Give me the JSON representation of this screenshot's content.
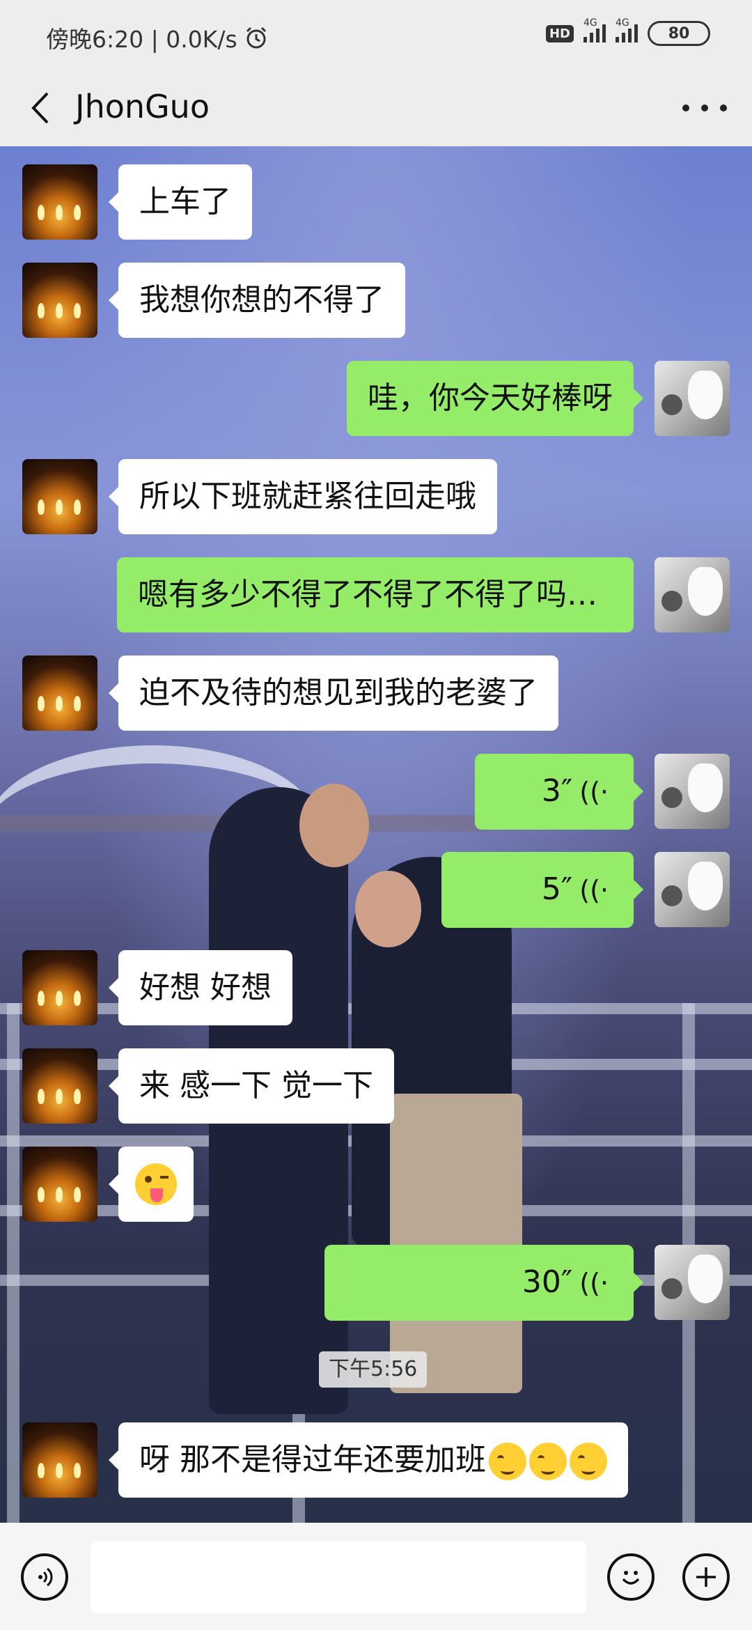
{
  "status_bar": {
    "time_speed": "傍晚6:20 | 0.0K/s",
    "alarm_icon": "alarm-icon",
    "hd": "HD",
    "network1": "4G",
    "network2": "4G",
    "battery": "80"
  },
  "header": {
    "back_icon": "back-chevron-icon",
    "title": "JhonGuo",
    "more_icon": "more-dots-icon"
  },
  "messages": [
    {
      "side": "in",
      "text": "上车了"
    },
    {
      "side": "in",
      "text": "我想你想的不得了"
    },
    {
      "side": "out",
      "text": "哇，你今天好棒呀"
    },
    {
      "side": "in",
      "text": "所以下班就赶紧往回走哦"
    },
    {
      "side": "out",
      "text": "嗯有多少不得了不得了不得了吗…"
    },
    {
      "side": "in",
      "text": "迫不及待的想见到我的老婆了"
    },
    {
      "side": "out",
      "type": "voice",
      "duration": "3″"
    },
    {
      "side": "out",
      "type": "voice",
      "duration": "5″"
    },
    {
      "side": "in",
      "text": "好想 好想"
    },
    {
      "side": "in",
      "text": "来 感一下 觉一下"
    },
    {
      "side": "in",
      "type": "emoji",
      "emoji": "winking-tongue-emoji"
    },
    {
      "side": "out",
      "type": "voice",
      "duration": "30″"
    },
    {
      "side": "in",
      "text": "呀 那不是得过年还要加班"
    }
  ],
  "timestamp": "下午5:56",
  "input_bar": {
    "voice_icon": "voice-input-icon",
    "emoji_icon": "emoji-icon",
    "plus_icon": "plus-icon",
    "text_value": ""
  },
  "colors": {
    "outgoing_bubble": "#95ec69",
    "incoming_bubble": "#ffffff",
    "header_bg": "#ededed"
  }
}
